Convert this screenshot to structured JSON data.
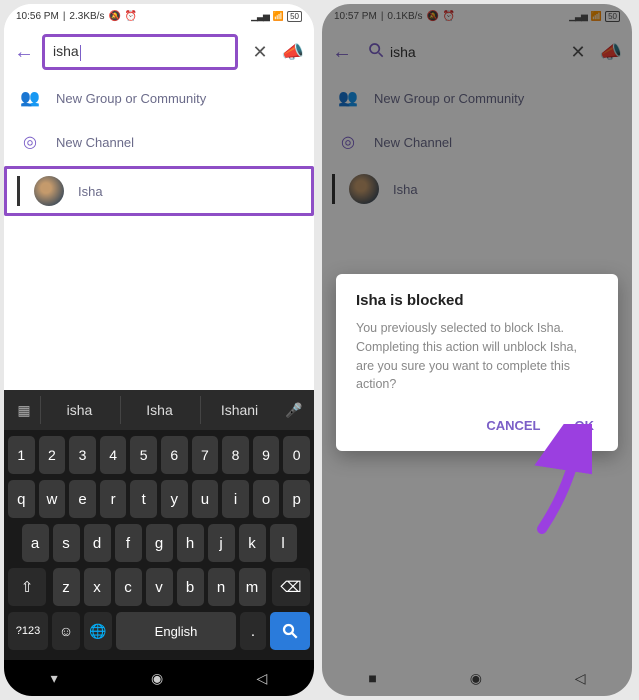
{
  "left": {
    "status": {
      "time": "10:56 PM",
      "net": "2.3KB/s",
      "icons": "📵 ⏰",
      "battery": "50"
    },
    "search": {
      "text": "isha",
      "placeholder": ""
    },
    "items": [
      {
        "label": "New Group or Community"
      },
      {
        "label": "New Channel"
      }
    ],
    "contact": {
      "name": "Isha"
    },
    "suggestions": [
      "isha",
      "Isha",
      "Ishani"
    ],
    "rows": {
      "nums": [
        "1",
        "2",
        "3",
        "4",
        "5",
        "6",
        "7",
        "8",
        "9",
        "0"
      ],
      "r1": [
        "q",
        "w",
        "e",
        "r",
        "t",
        "y",
        "u",
        "i",
        "o",
        "p"
      ],
      "r2": [
        "a",
        "s",
        "d",
        "f",
        "g",
        "h",
        "j",
        "k",
        "l"
      ],
      "r3": [
        "z",
        "x",
        "c",
        "v",
        "b",
        "n",
        "m"
      ]
    },
    "space_label": "English",
    "sym_label": "?123"
  },
  "right": {
    "status": {
      "time": "10:57 PM",
      "net": "0.1KB/s",
      "icons": "📵 ⏰",
      "battery": "50"
    },
    "search": {
      "text": "isha"
    },
    "items": [
      {
        "label": "New Group or Community"
      },
      {
        "label": "New Channel"
      }
    ],
    "contact": {
      "name": "Isha"
    },
    "dialog": {
      "title": "Isha is blocked",
      "body": "You previously selected to block Isha. Completing this action will unblock Isha, are you sure you want to complete this action?",
      "cancel": "CANCEL",
      "ok": "OK"
    }
  }
}
